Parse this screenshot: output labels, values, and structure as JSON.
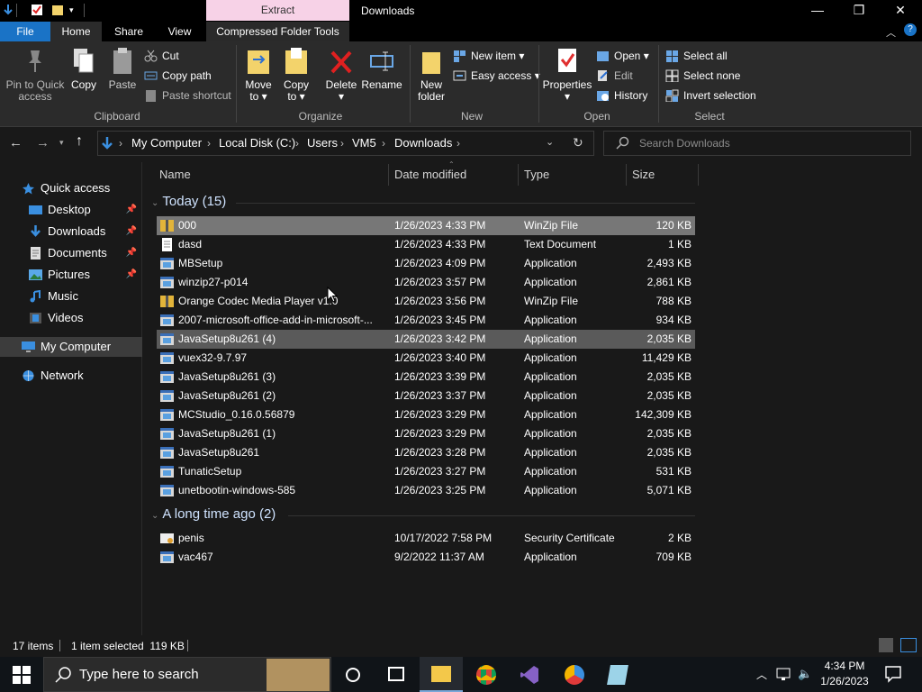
{
  "titlebar": {
    "title": "Downloads",
    "context_tab": "Extract",
    "minimize": "—",
    "maximize": "❐",
    "close": "✕"
  },
  "ribbon_tabs": {
    "file": "File",
    "home": "Home",
    "share": "Share",
    "view": "View",
    "compressed": "Compressed Folder Tools"
  },
  "ribbon": {
    "clipboard": {
      "pin_line1": "Pin to Quick",
      "pin_line2": "access",
      "copy": "Copy",
      "paste": "Paste",
      "cut": "Cut",
      "copy_path": "Copy path",
      "paste_shortcut": "Paste shortcut",
      "group": "Clipboard"
    },
    "organize": {
      "move_line1": "Move",
      "move_line2": "to",
      "copyto_line1": "Copy",
      "copyto_line2": "to",
      "delete": "Delete",
      "rename": "Rename",
      "group": "Organize"
    },
    "new": {
      "new_folder_line1": "New",
      "new_folder_line2": "folder",
      "new_item": "New item",
      "easy_access": "Easy access",
      "group": "New"
    },
    "open": {
      "properties": "Properties",
      "open": "Open",
      "edit": "Edit",
      "history": "History",
      "group": "Open"
    },
    "select": {
      "select_all": "Select all",
      "select_none": "Select none",
      "invert": "Invert selection",
      "group": "Select"
    }
  },
  "address": {
    "crumbs": [
      "My Computer",
      "Local Disk (C:)",
      "Users",
      "VM5",
      "Downloads"
    ],
    "search_placeholder": "Search Downloads"
  },
  "nav": {
    "items": [
      {
        "label": "Quick access"
      },
      {
        "label": "Desktop"
      },
      {
        "label": "Downloads"
      },
      {
        "label": "Documents"
      },
      {
        "label": "Pictures"
      },
      {
        "label": "Music"
      },
      {
        "label": "Videos"
      },
      {
        "label": "My Computer"
      },
      {
        "label": "Network"
      }
    ]
  },
  "columns": {
    "name": "Name",
    "date": "Date modified",
    "type": "Type",
    "size": "Size"
  },
  "groups": [
    {
      "title": "Today (15)",
      "files": [
        {
          "name": "000",
          "date": "1/26/2023 4:33 PM",
          "type": "WinZip File",
          "size": "120 KB"
        },
        {
          "name": "dasd",
          "date": "1/26/2023 4:33 PM",
          "type": "Text Document",
          "size": "1 KB"
        },
        {
          "name": "MBSetup",
          "date": "1/26/2023 4:09 PM",
          "type": "Application",
          "size": "2,493 KB"
        },
        {
          "name": "winzip27-p014",
          "date": "1/26/2023 3:57 PM",
          "type": "Application",
          "size": "2,861 KB"
        },
        {
          "name": "Orange Codec Media Player v1.0",
          "date": "1/26/2023 3:56 PM",
          "type": "WinZip File",
          "size": "788 KB"
        },
        {
          "name": "2007-microsoft-office-add-in-microsoft-...",
          "date": "1/26/2023 3:45 PM",
          "type": "Application",
          "size": "934 KB"
        },
        {
          "name": "JavaSetup8u261 (4)",
          "date": "1/26/2023 3:42 PM",
          "type": "Application",
          "size": "2,035 KB"
        },
        {
          "name": "vuex32-9.7.97",
          "date": "1/26/2023 3:40 PM",
          "type": "Application",
          "size": "11,429 KB"
        },
        {
          "name": "JavaSetup8u261 (3)",
          "date": "1/26/2023 3:39 PM",
          "type": "Application",
          "size": "2,035 KB"
        },
        {
          "name": "JavaSetup8u261 (2)",
          "date": "1/26/2023 3:37 PM",
          "type": "Application",
          "size": "2,035 KB"
        },
        {
          "name": "MCStudio_0.16.0.56879",
          "date": "1/26/2023 3:29 PM",
          "type": "Application",
          "size": "142,309 KB"
        },
        {
          "name": "JavaSetup8u261 (1)",
          "date": "1/26/2023 3:29 PM",
          "type": "Application",
          "size": "2,035 KB"
        },
        {
          "name": "JavaSetup8u261",
          "date": "1/26/2023 3:28 PM",
          "type": "Application",
          "size": "2,035 KB"
        },
        {
          "name": "TunaticSetup",
          "date": "1/26/2023 3:27 PM",
          "type": "Application",
          "size": "531 KB"
        },
        {
          "name": "unetbootin-windows-585",
          "date": "1/26/2023 3:25 PM",
          "type": "Application",
          "size": "5,071 KB"
        }
      ]
    },
    {
      "title": "A long time ago (2)",
      "files": [
        {
          "name": "penis",
          "date": "10/17/2022 7:58 PM",
          "type": "Security Certificate",
          "size": "2 KB"
        },
        {
          "name": "vac467",
          "date": "9/2/2022 11:37 AM",
          "type": "Application",
          "size": "709 KB"
        }
      ]
    }
  ],
  "status": {
    "items": "17 items",
    "selected": "1 item selected  119 KB"
  },
  "taskbar": {
    "search_placeholder": "Type here to search",
    "time": "4:34 PM",
    "date": "1/26/2023"
  },
  "colors": {
    "accent": "#1a73c6",
    "selected_row": "#777777",
    "hover_row": "#5a5a5a",
    "context_tab": "#f7d2e7"
  }
}
